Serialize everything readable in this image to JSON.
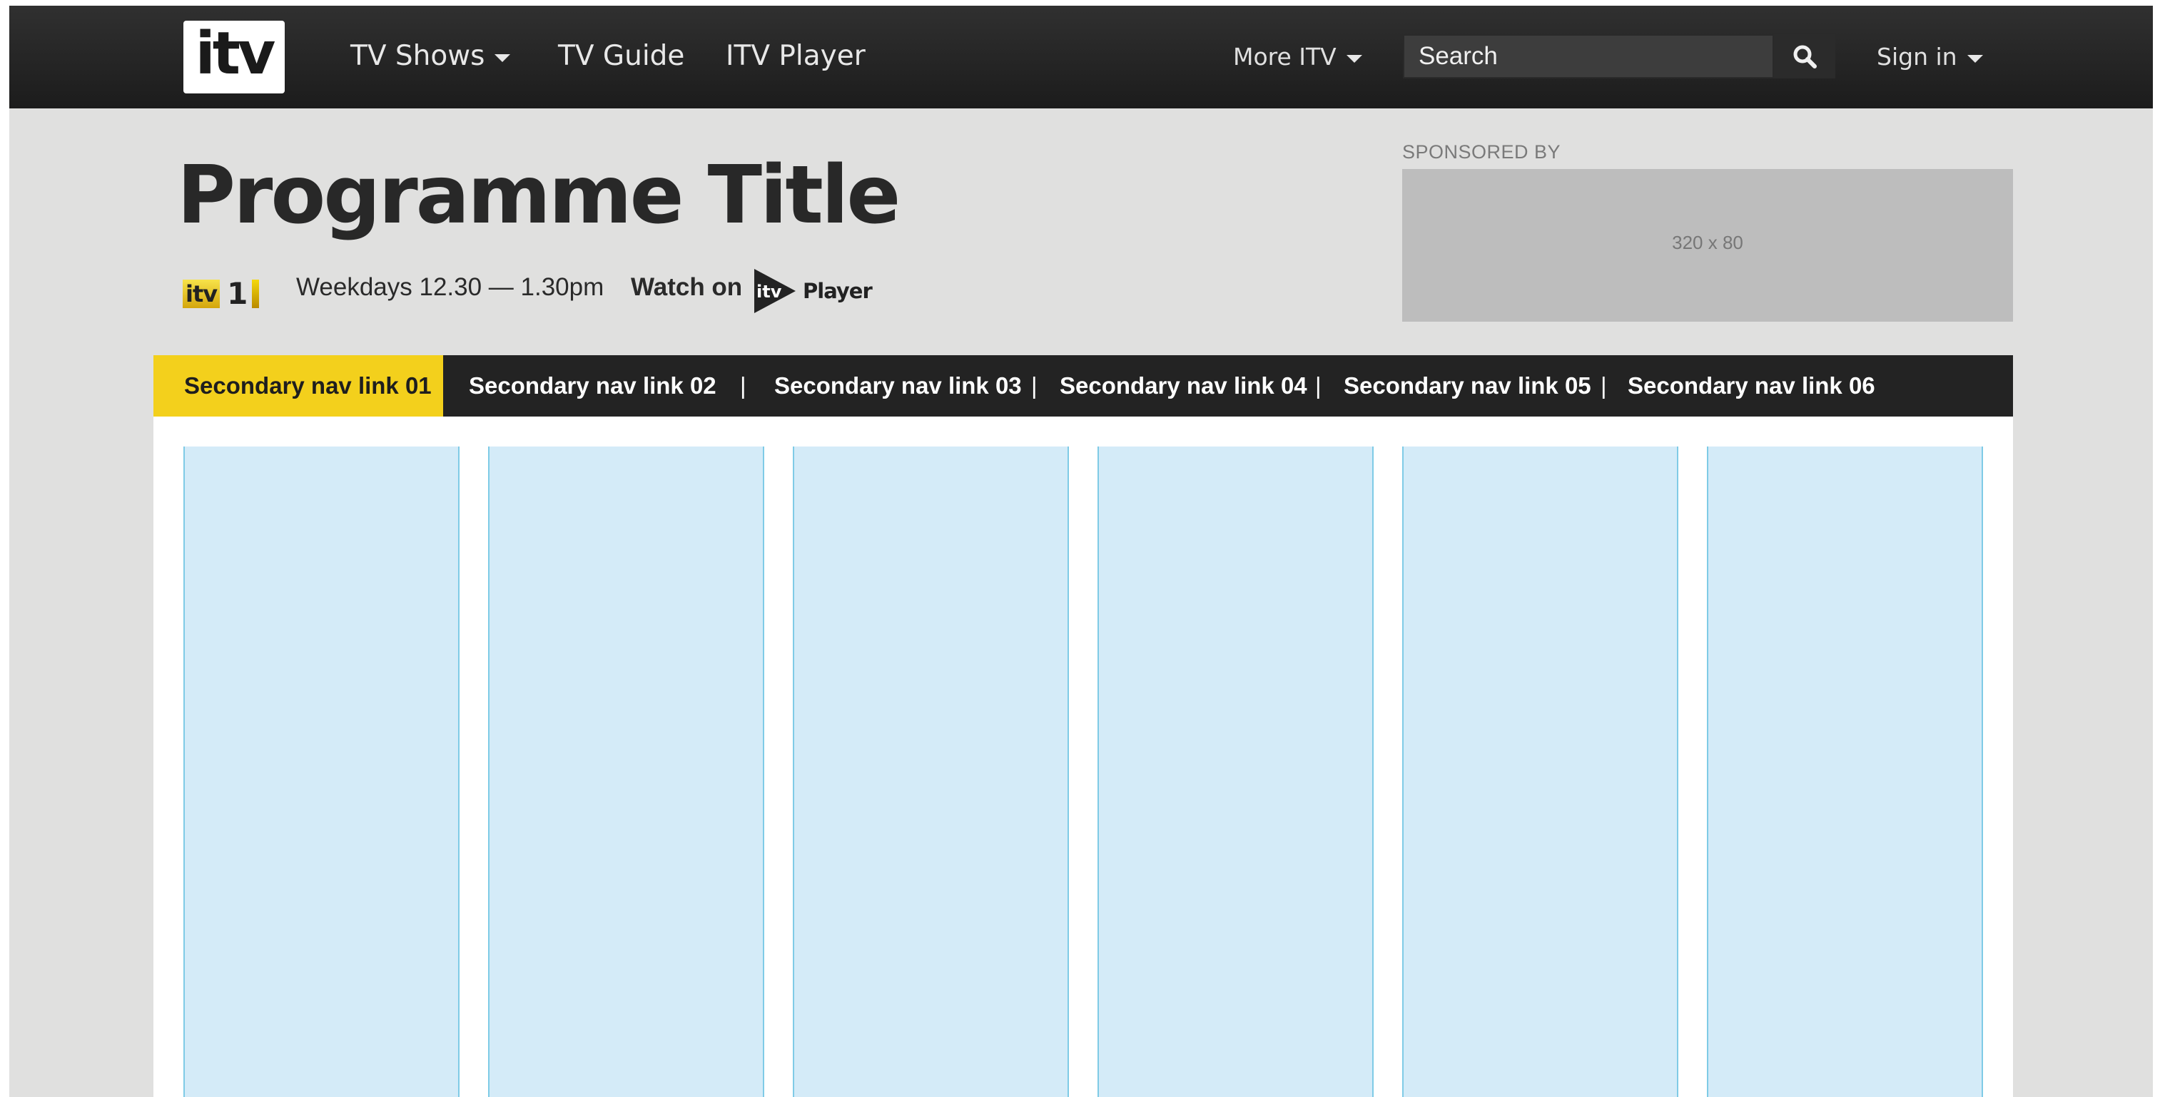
{
  "header": {
    "logo_text": "itv",
    "nav": [
      {
        "label": "TV Shows",
        "has_dropdown": true
      },
      {
        "label": "TV Guide",
        "has_dropdown": false
      },
      {
        "label": "ITV Player",
        "has_dropdown": false
      }
    ],
    "more_label": "More ITV",
    "search": {
      "placeholder": "Search",
      "value": "",
      "icon": "search-icon"
    },
    "signin_label": "Sign in"
  },
  "programme": {
    "title": "Programme Title",
    "channel": {
      "brand": "itv",
      "number": "1"
    },
    "schedule": "Weekdays 12.30 — 1.30pm",
    "watch_on_label": "Watch on",
    "player_brand": {
      "itv": "itv",
      "player": "Player"
    }
  },
  "sponsor": {
    "label": "SPONSORED BY",
    "ad_size": "320 x 80"
  },
  "secondary_nav": {
    "items": [
      {
        "label": "Secondary nav link 01",
        "active": true
      },
      {
        "label": "Secondary nav link 02",
        "active": false
      },
      {
        "label": "Secondary nav link 03",
        "active": false
      },
      {
        "label": "Secondary nav link 04",
        "active": false
      },
      {
        "label": "Secondary nav link 05",
        "active": false
      },
      {
        "label": "Secondary nav link 06",
        "active": false
      }
    ],
    "separator": "|"
  },
  "colors": {
    "header_bg": "#232323",
    "page_bg": "#e0e0df",
    "accent_yellow": "#f3d01c",
    "column_fill": "#d4ebf8",
    "column_border": "#7fcbe6"
  }
}
